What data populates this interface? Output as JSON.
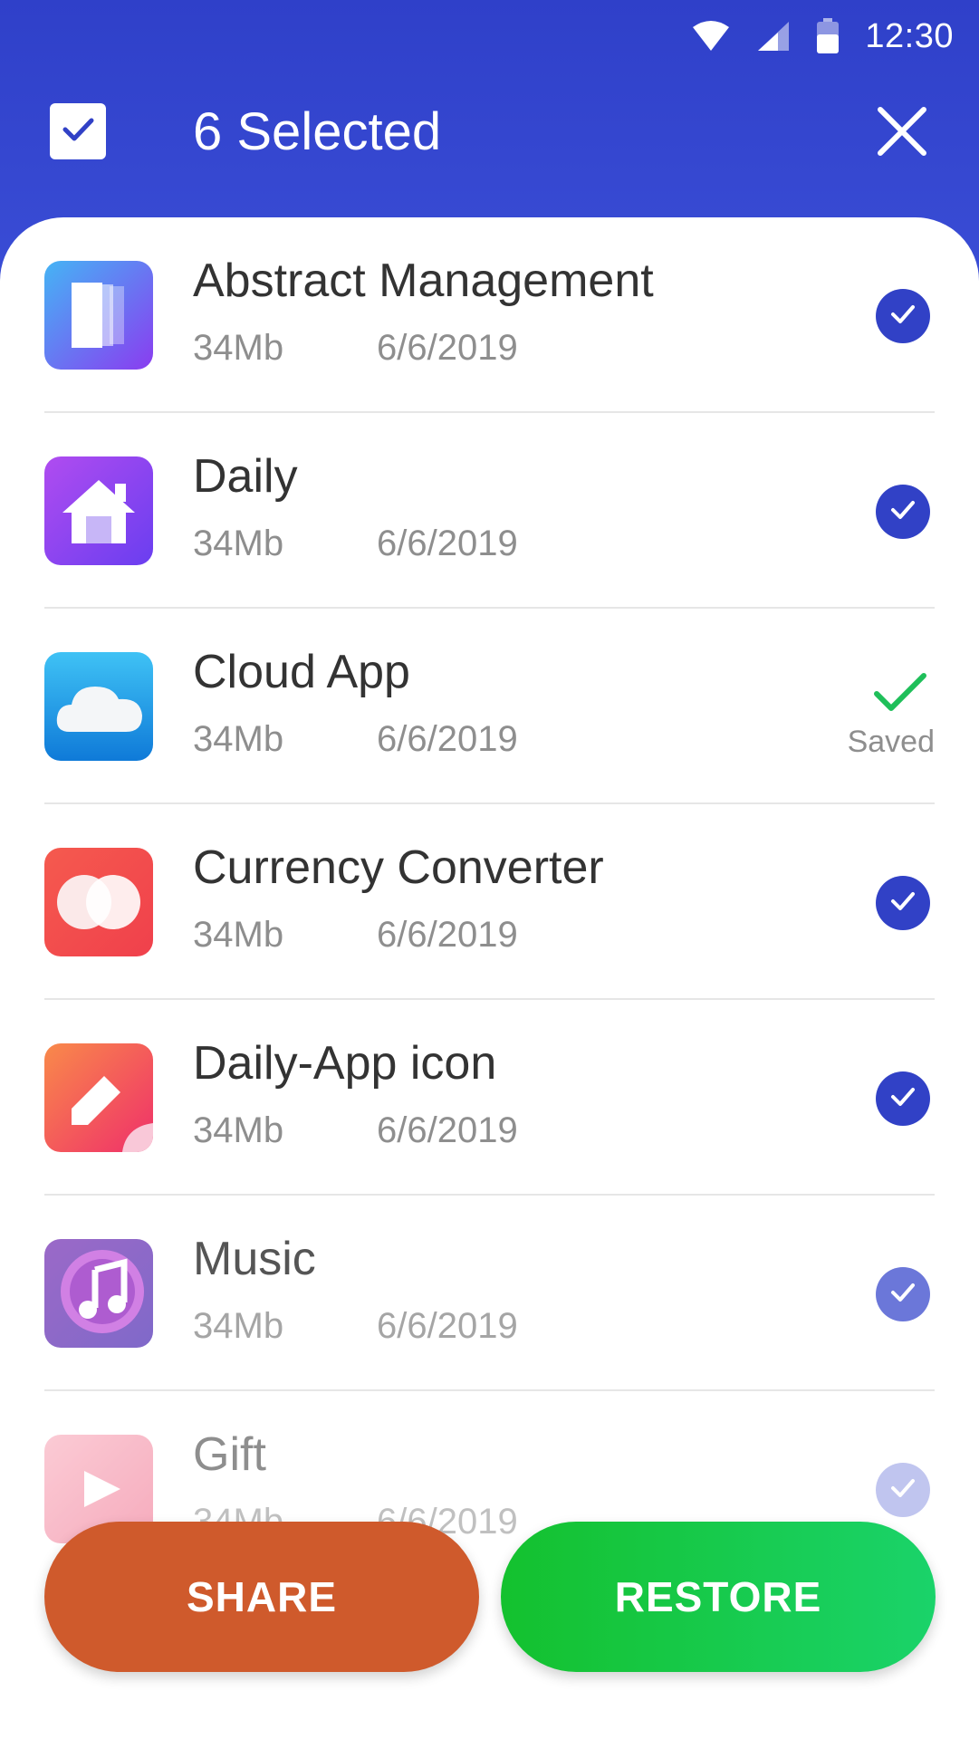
{
  "status_bar": {
    "time": "12:30",
    "icons": [
      "wifi-icon",
      "cellular-signal-icon",
      "battery-icon"
    ]
  },
  "header": {
    "select_all_icon": "checkbox-checked-icon",
    "title": "6 Selected",
    "close_icon": "close-icon"
  },
  "colors": {
    "header_bg": "#3344cf",
    "check_blue": "#3141c6",
    "saved_green": "#1fbf5a",
    "share_orange": "#cf5a2c",
    "restore_green": "#16c84a"
  },
  "apps": [
    {
      "name": "Abstract Management",
      "size": "34Mb",
      "date": "6/6/2019",
      "icon": "abstract-management-app-icon",
      "state": "selected"
    },
    {
      "name": "Daily",
      "size": "34Mb",
      "date": "6/6/2019",
      "icon": "daily-home-app-icon",
      "state": "selected"
    },
    {
      "name": "Cloud App",
      "size": "34Mb",
      "date": "6/6/2019",
      "icon": "cloud-app-icon",
      "state": "saved",
      "status_label": "Saved"
    },
    {
      "name": "Currency Converter",
      "size": "34Mb",
      "date": "6/6/2019",
      "icon": "currency-converter-app-icon",
      "state": "selected"
    },
    {
      "name": "Daily-App icon",
      "size": "34Mb",
      "date": "6/6/2019",
      "icon": "daily-app-pencil-icon",
      "state": "selected"
    },
    {
      "name": "Music",
      "size": "34Mb",
      "date": "6/6/2019",
      "icon": "music-app-icon",
      "state": "selected"
    },
    {
      "name": "Gift",
      "size": "34Mb",
      "date": "6/6/2019",
      "icon": "gift-play-app-icon",
      "state": "selected"
    }
  ],
  "actions": {
    "share_label": "SHARE",
    "restore_label": "RESTORE"
  }
}
